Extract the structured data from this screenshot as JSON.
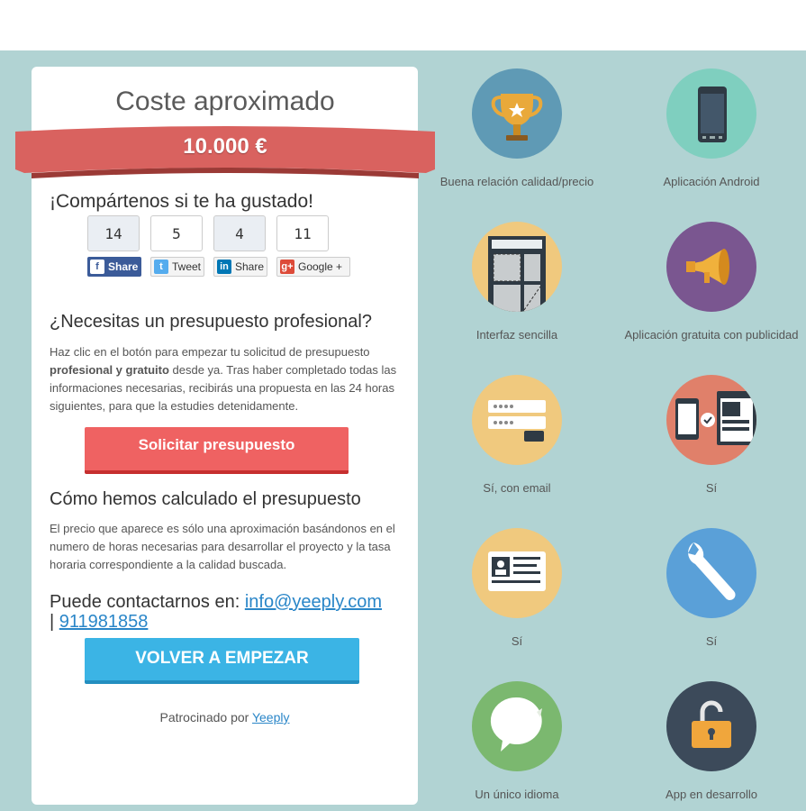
{
  "summary": {
    "title": "Coste aproximado",
    "price": "10.000 €"
  },
  "share": {
    "title": "¡Compártenos si te ha gustado!",
    "buttons": [
      {
        "count": "14",
        "label": "Share"
      },
      {
        "count": "5",
        "label": "Tweet"
      },
      {
        "count": "4",
        "label": "Share"
      },
      {
        "count": "11",
        "label": "Google +"
      }
    ]
  },
  "quote": {
    "heading": "¿Necesitas un presupuesto profesional?",
    "text_before": "Haz clic en el botón para empezar tu solicitud de presupuesto ",
    "text_bold": "profesional y gratuito",
    "text_after": " desde ya. Tras haber completado todas las informaciones necesarias, recibirás una propuesta en las 24 horas siguientes, para que la estudies detenidamente.",
    "button": "Solicitar presupuesto"
  },
  "calc": {
    "heading": "Cómo hemos calculado el presupuesto",
    "text": "El precio que aparece es sólo una aproximación basándonos en el numero de horas necesarias para desarrollar el proyecto y la tasa horaria correspondiente a la calidad buscada."
  },
  "contact": {
    "prefix": "Puede contactarnos en: ",
    "email": "info@yeeply.com",
    "separator": "| ",
    "phone": "911981858"
  },
  "restart_button": "VOLVER A EMPEZAR",
  "sponsor": {
    "prefix": "Patrocinado por ",
    "link": "Yeeply"
  },
  "features": [
    {
      "label": "Buena relación calidad/precio",
      "icon": "trophy-icon",
      "color": "#5f9ab5"
    },
    {
      "label": "Aplicación Android",
      "icon": "smartphone-icon",
      "color": "#7fcfbf"
    },
    {
      "label": "Interfaz sencilla",
      "icon": "interface-layout-icon",
      "color": "#f0c97e"
    },
    {
      "label": "Aplicación gratuita con publicidad",
      "icon": "megaphone-icon",
      "color": "#7a5690"
    },
    {
      "label": "Sí, con email",
      "icon": "login-form-icon",
      "color": "#f0c97e"
    },
    {
      "label": "Sí",
      "icon": "multi-device-icon",
      "color": "#e0806a"
    },
    {
      "label": "Sí",
      "icon": "id-card-icon",
      "color": "#f0c97e"
    },
    {
      "label": "Sí",
      "icon": "wrench-icon",
      "color": "#5aa0d8"
    },
    {
      "label": "Un único idioma",
      "icon": "speech-bubble-icon",
      "color": "#7bb86f"
    },
    {
      "label": "App en desarrollo",
      "icon": "padlock-open-icon",
      "color": "#3c4a5a"
    }
  ],
  "colors": {
    "background": "#b1d3d3",
    "ribbon": "#d9625f",
    "quote_button": "#ef6262",
    "restart_button": "#3bb4e5",
    "link": "#2a86c8"
  }
}
